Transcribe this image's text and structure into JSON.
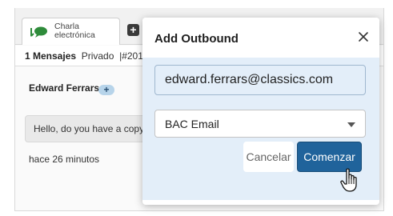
{
  "chat": {
    "tab_label": "Charla electrónica",
    "add_tab_symbol": "+",
    "info": {
      "message_count": "1 Mensajes",
      "privacy": "Privado",
      "id_fragment": "|#201"
    },
    "sender_name": "Edward Ferrars",
    "sender_plus": "+",
    "message_text": "Hello, do you have a copy",
    "timestamp": "hace 26 minutos"
  },
  "modal": {
    "title": "Add Outbound",
    "close_icon": "close-icon",
    "email_value": "edward.ferrars@classics.com",
    "channel_selected": "BAC Email",
    "cancel_label": "Cancelar",
    "start_label": "Comenzar"
  },
  "colors": {
    "primary_button": "#20639b",
    "modal_body_bg": "#e3eef9",
    "chat_icon_green": "#2e8b3a"
  }
}
